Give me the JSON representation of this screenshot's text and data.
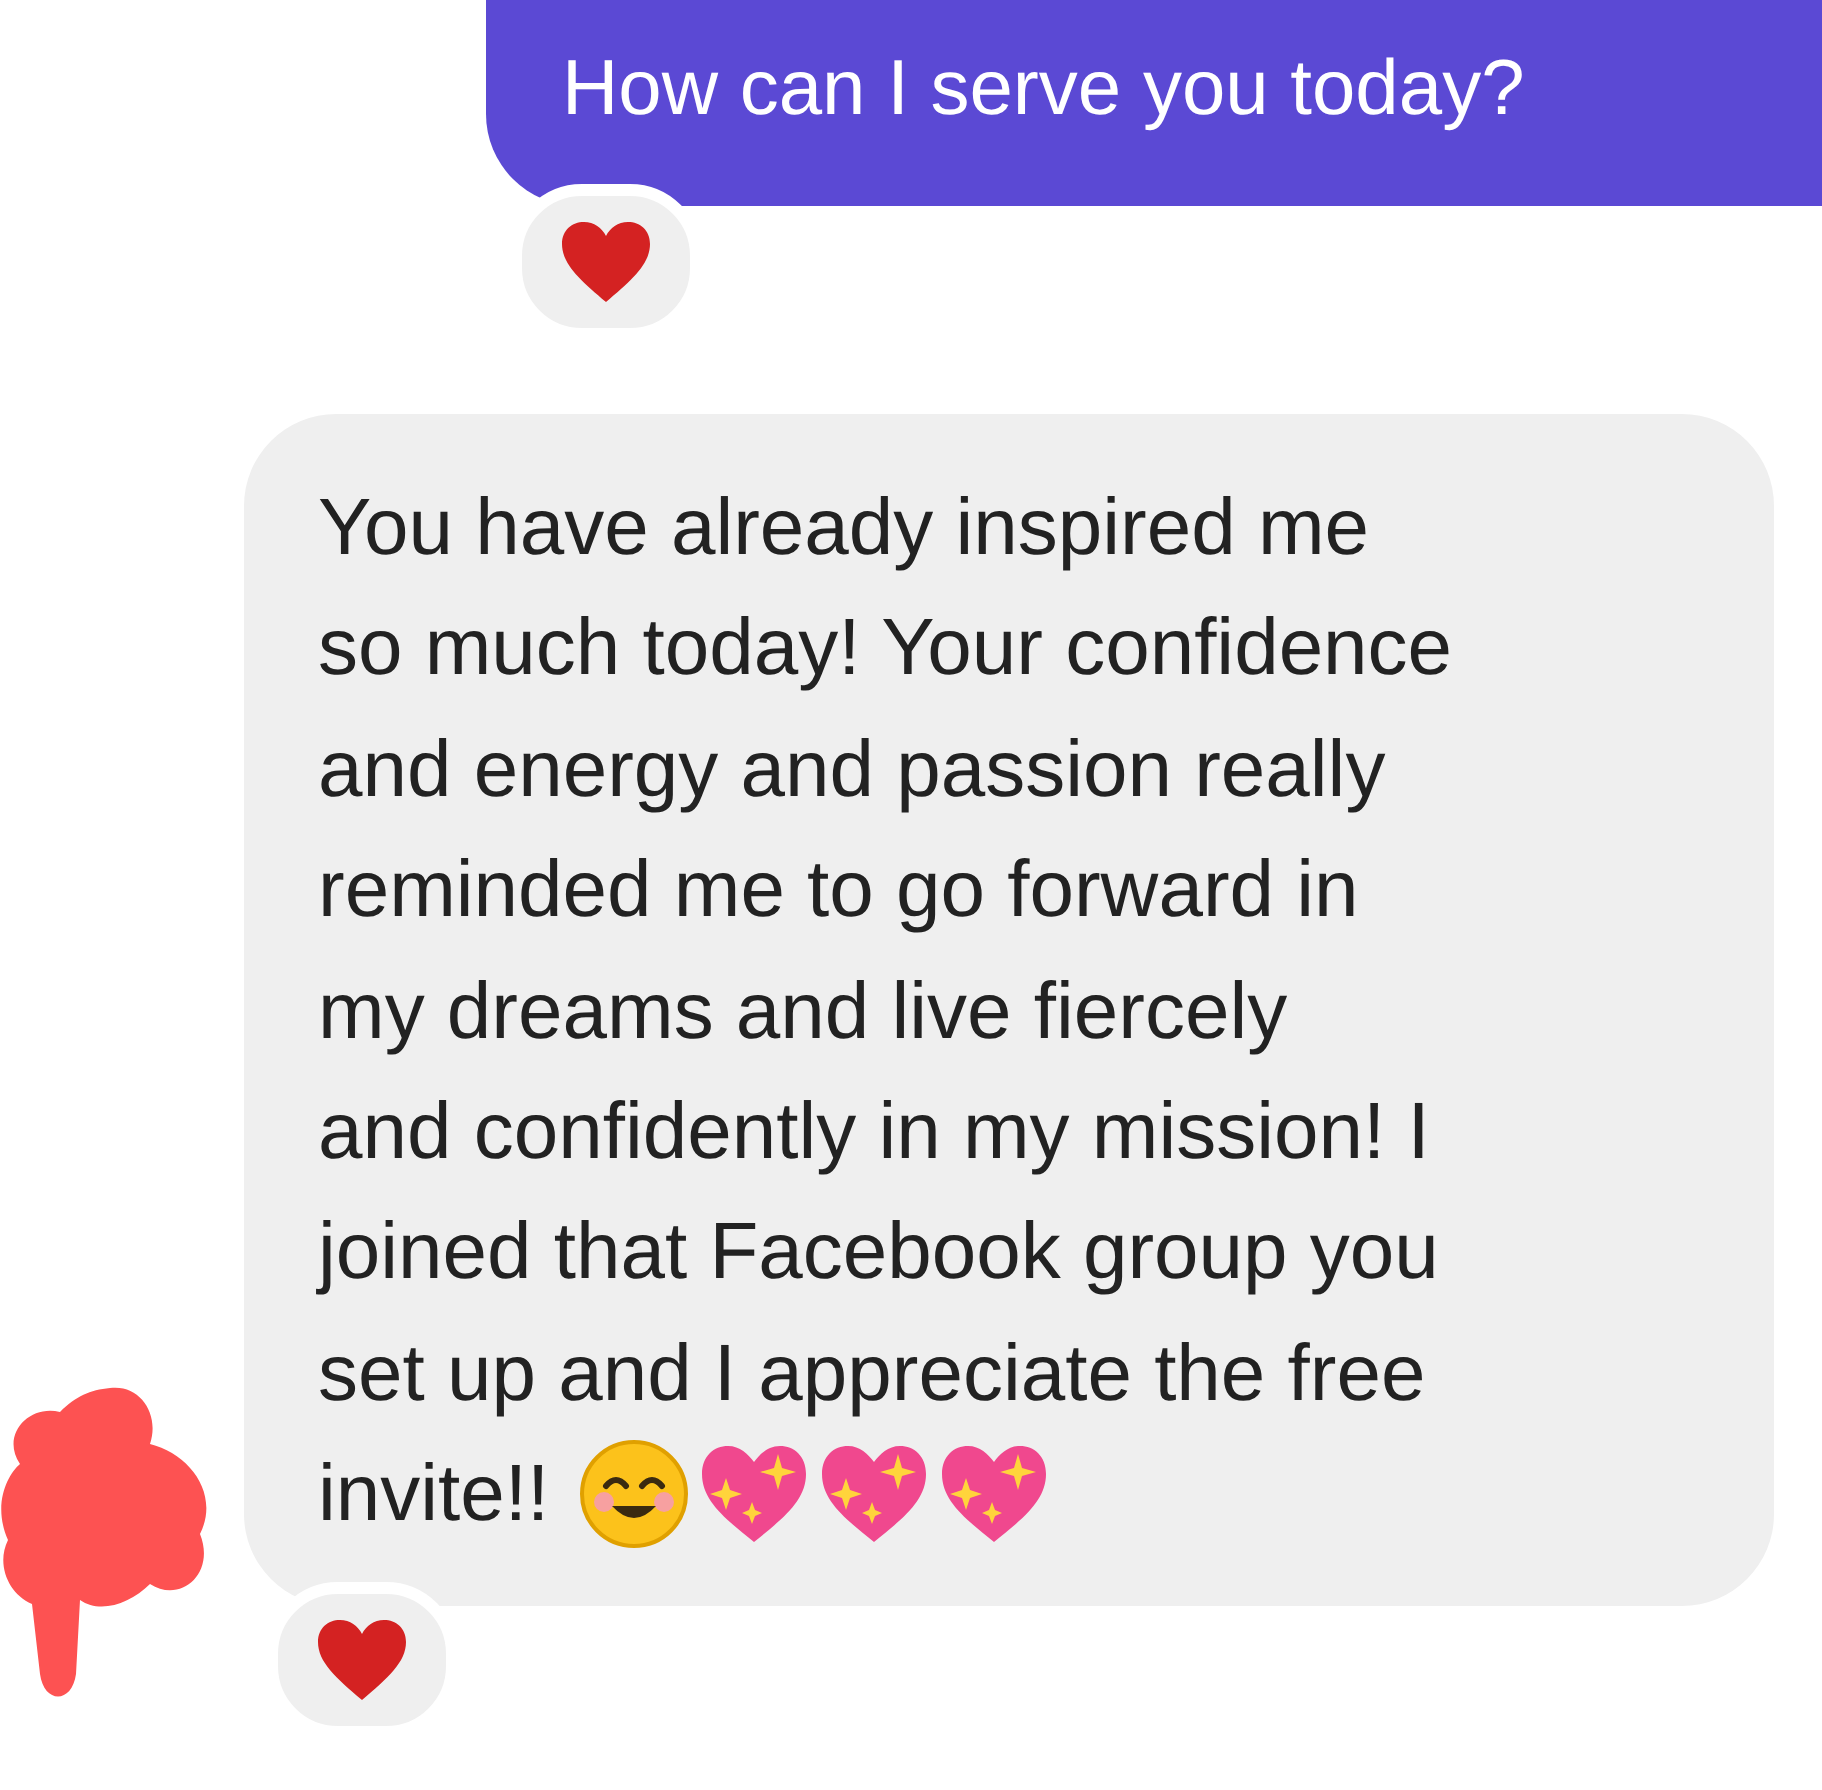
{
  "messages": [
    {
      "kind": "sent",
      "lines": [
        "How can I serve you today?"
      ],
      "reaction": {
        "kind": "heart"
      }
    },
    {
      "kind": "received",
      "lines": [
        "You have already inspired me",
        "so much today! Your confidence",
        "and energy and passion really",
        "reminded me to go forward in",
        "my dreams and live fiercely",
        "and confidently in my mission! I",
        "joined that Facebook group you",
        "set up and I appreciate the free",
        "invite!!"
      ],
      "emoji": [
        {
          "kind": "smiling-face"
        },
        {
          "kind": "sparkling-heart"
        },
        {
          "kind": "sparkling-heart"
        },
        {
          "kind": "sparkling-heart"
        }
      ],
      "reaction": {
        "kind": "heart"
      },
      "redacted_avatar": true
    }
  ]
}
